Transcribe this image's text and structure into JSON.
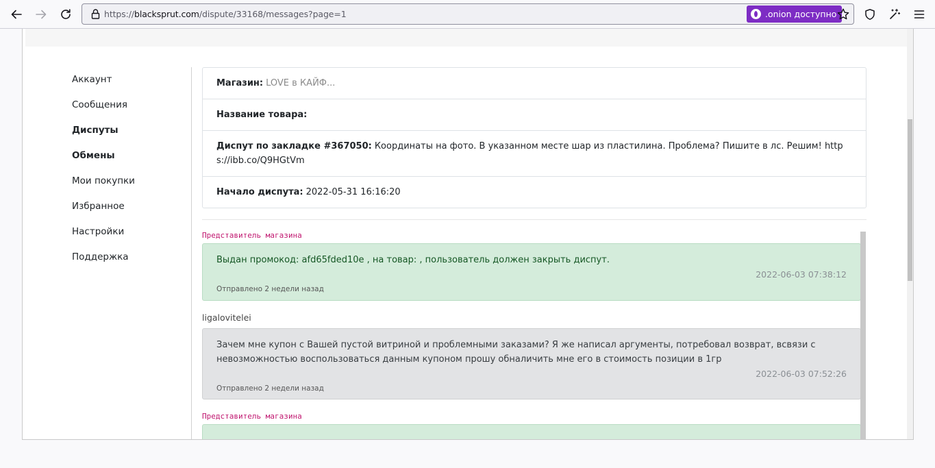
{
  "browser": {
    "url_prefix": "https://",
    "url_host": "blacksprut.com",
    "url_path": "/dispute/33168/messages?page=1",
    "onion_label": ".onion доступно"
  },
  "sidebar": {
    "items": [
      {
        "label": "Аккаунт",
        "bold": false
      },
      {
        "label": "Сообщения",
        "bold": false
      },
      {
        "label": "Диспуты",
        "bold": true
      },
      {
        "label": "Обмены",
        "bold": true
      },
      {
        "label": "Мои покупки",
        "bold": false
      },
      {
        "label": "Избранное",
        "bold": false
      },
      {
        "label": "Настройки",
        "bold": false
      },
      {
        "label": "Поддержка",
        "bold": false
      }
    ]
  },
  "dispute_info": {
    "shop_label": "Магазин:",
    "shop_value": "LOVE в КАЙФ...",
    "product_label": "Название товара:",
    "product_value": "",
    "dispute_label": "Диспут по закладке #367050:",
    "dispute_value": "Координаты на фото. В указанном месте шар из пластилина. Проблема? Пишите в лс. Решим! https://ibb.co/Q9HGtVm",
    "start_label": "Начало диспута:",
    "start_value": "2022-05-31 16:16:20"
  },
  "messages": [
    {
      "author": "Представитель магазина",
      "role": "store",
      "text": "Выдан промокод: afd65fded10e , на товар: , пользователь должен закрыть диспут.",
      "time": "2022-06-03 07:38:12",
      "sent": "Отправлено 2 недели назад"
    },
    {
      "author": "ligalovitelei",
      "role": "buyer",
      "text": "Зачем мне купон с Вашей пустой витриной и проблемными заказами? Я же написал аргументы, потребовал возврат, всвязи с невозможностью воспользоваться данным купоном прошу обналичить мне его в стоимость позиции в 1гр",
      "time": "2022-06-03 07:52:26",
      "sent": "Отправлено 2 недели назад"
    },
    {
      "author": "Представитель магазина",
      "role": "store",
      "text": "",
      "time": "",
      "sent": ""
    }
  ],
  "colors": {
    "onion_badge": "#7d2cc4",
    "store_author": "#c0166f",
    "store_bubble": "#d4ecdb",
    "buyer_bubble": "#e2e3e5"
  }
}
